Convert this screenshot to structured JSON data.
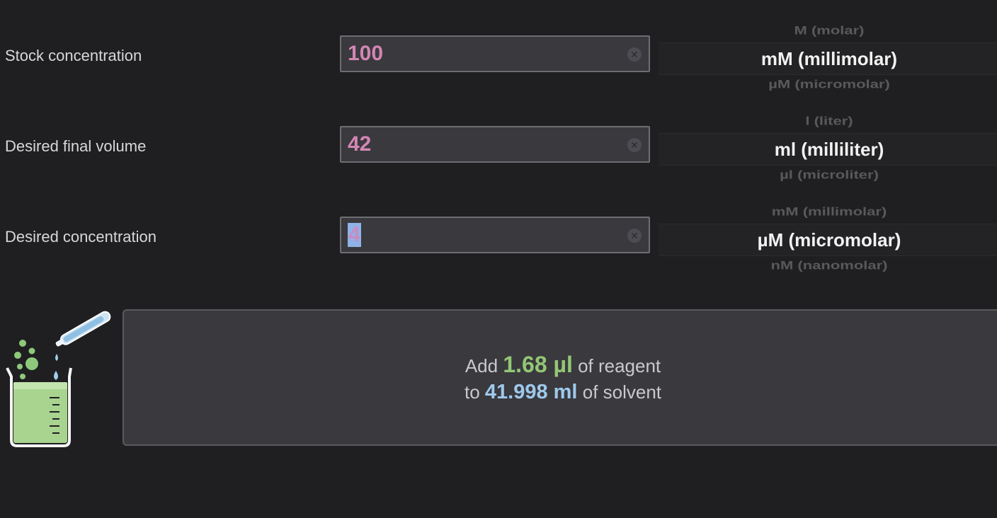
{
  "fields": [
    {
      "label": "Stock concentration",
      "value": "100",
      "selected": false,
      "unit_prev": "M (molar)",
      "unit_selected": "mM (millimolar)",
      "unit_next": "µM (micromolar)"
    },
    {
      "label": "Desired final volume",
      "value": "42",
      "selected": false,
      "unit_prev": "l (liter)",
      "unit_selected": "ml (milliliter)",
      "unit_next": "µl (microliter)"
    },
    {
      "label": "Desired concentration",
      "value": "4",
      "selected": true,
      "unit_prev": "mM (millimolar)",
      "unit_selected": "µM (micromolar)",
      "unit_next": "nM (nanomolar)"
    }
  ],
  "clear_icon": "clear-circle-x",
  "illustration_icon": "beaker-with-pipette",
  "result": {
    "add_prefix": "Add",
    "reagent_amount": "1.68 µl",
    "reagent_suffix": "of reagent",
    "to_prefix": "to",
    "solvent_amount": "41.998 ml",
    "solvent_suffix": "of solvent"
  },
  "colors": {
    "background": "#1f1f21",
    "input_value": "#d286b3",
    "reagent_amount": "#93c775",
    "solvent_amount": "#9ec9ec",
    "selection": "#8fb2e8"
  }
}
